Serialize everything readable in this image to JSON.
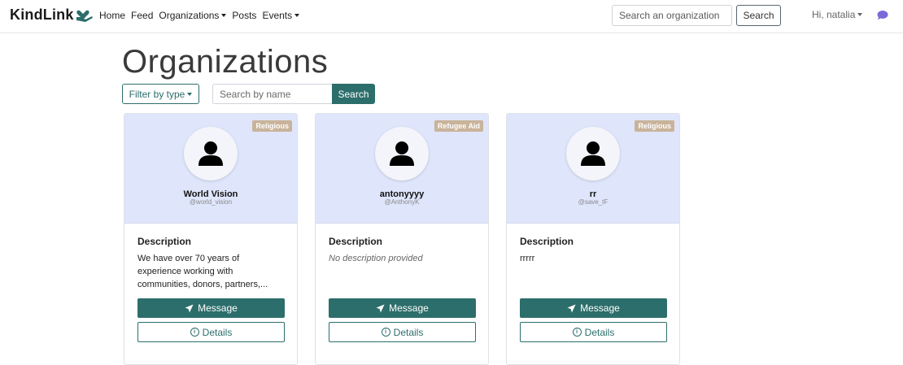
{
  "navbar": {
    "brand": "KindLink",
    "links": [
      {
        "label": "Home",
        "dropdown": false
      },
      {
        "label": "Feed",
        "dropdown": false
      },
      {
        "label": "Organizations",
        "dropdown": true
      },
      {
        "label": "Posts",
        "dropdown": false
      },
      {
        "label": "Events",
        "dropdown": true
      }
    ],
    "search_placeholder": "Search an organization",
    "search_button": "Search",
    "user_greeting": "Hi, natalia",
    "chat_icon": "chat-bubble-icon"
  },
  "page": {
    "title": "Organizations",
    "filter_label": "Filter by type",
    "name_search_placeholder": "Search by name",
    "name_search_button": "Search"
  },
  "cards": [
    {
      "badge": "Religious",
      "name": "World Vision",
      "handle": "@world_vision",
      "description_title": "Description",
      "description": "We have over 70 years of experience working with communities, donors, partners,...",
      "message_label": "Message",
      "details_label": "Details"
    },
    {
      "badge": "Refugee Aid",
      "name": "antonyyyy",
      "handle": "@AnthonyK",
      "description_title": "Description",
      "description": "No description provided",
      "message_label": "Message",
      "details_label": "Details"
    },
    {
      "badge": "Religious",
      "name": "rr",
      "handle": "@save_tF",
      "description_title": "Description",
      "description": "rrrrr",
      "message_label": "Message",
      "details_label": "Details"
    }
  ],
  "colors": {
    "accent": "#2c6e6b",
    "card_header": "#dfe5fb",
    "badge": "#c9b39a"
  }
}
